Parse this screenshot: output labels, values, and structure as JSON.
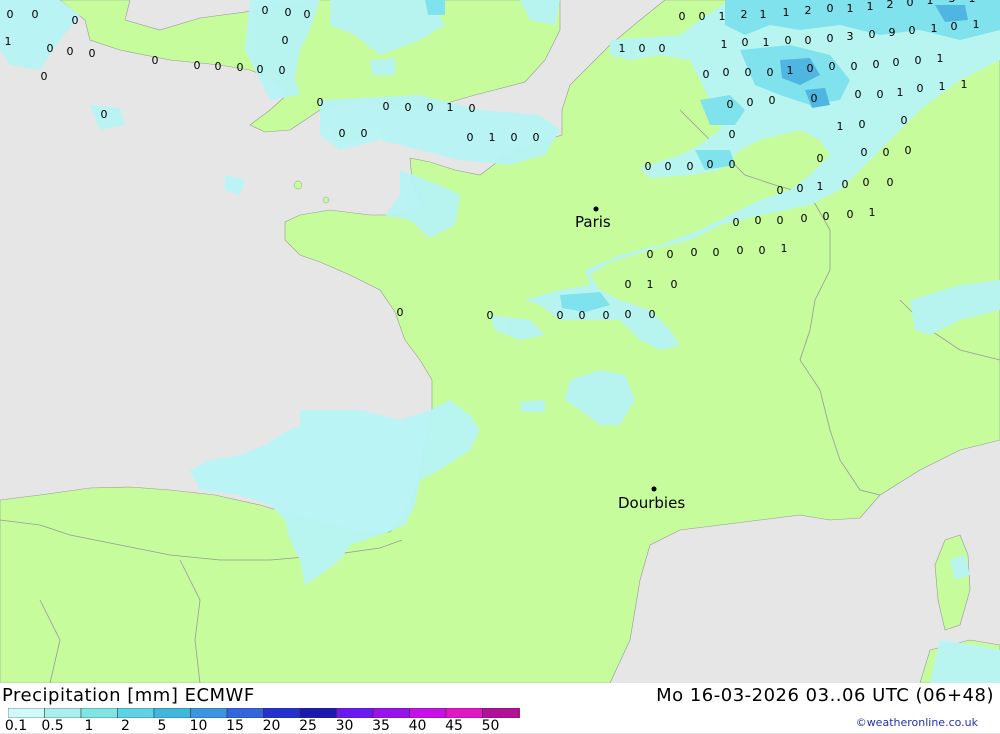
{
  "map": {
    "cities": [
      {
        "name": "Paris"
      },
      {
        "name": "Dourbies"
      }
    ],
    "value_labels": [
      "0",
      "0",
      "0",
      "0",
      "1",
      "0",
      "0",
      "0",
      "0",
      "0",
      "0",
      "0",
      "0",
      "0",
      "0",
      "0",
      "0",
      "0",
      "0",
      "0",
      "0",
      "0",
      "0",
      "0",
      "1",
      "0",
      "0",
      "0",
      "0",
      "1",
      "0",
      "0",
      "1",
      "0",
      "0",
      "0",
      "0",
      "1",
      "2",
      "1",
      "1",
      "2",
      "0",
      "1",
      "1",
      "2",
      "0",
      "1",
      "3",
      "1",
      "1",
      "0",
      "1",
      "0",
      "0",
      "0",
      "3",
      "0",
      "9",
      "0",
      "1",
      "0",
      "1",
      "0",
      "0",
      "0",
      "0",
      "1",
      "0",
      "0",
      "0",
      "0",
      "0",
      "0",
      "1",
      "0",
      "0",
      "0",
      "0",
      "0",
      "0",
      "1",
      "0",
      "1",
      "1",
      "1",
      "0",
      "0",
      "0",
      "0",
      "0",
      "0",
      "0",
      "0",
      "0",
      "0",
      "0",
      "0",
      "0",
      "0",
      "1",
      "0",
      "0",
      "0",
      "0",
      "0",
      "0",
      "0",
      "0",
      "0",
      "1",
      "0",
      "0",
      "0",
      "0",
      "0",
      "0",
      "1",
      "0",
      "1",
      "0",
      "0",
      "0",
      "0",
      "0",
      "0",
      "0",
      "0"
    ]
  },
  "footer": {
    "title": "Precipitation [mm] ECMWF",
    "datetime": "Mo 16-03-2026 03..06 UTC (06+48)",
    "credit": "©weatheronline.co.uk"
  },
  "legend": {
    "labels": [
      "0.1",
      "0.5",
      "1",
      "2",
      "5",
      "10",
      "15",
      "20",
      "25",
      "30",
      "35",
      "40",
      "45",
      "50"
    ],
    "colors": [
      "#cffafa",
      "#a8f0f0",
      "#7fe6e6",
      "#5cd4e6",
      "#3fb8e0",
      "#3a96e0",
      "#3366dd",
      "#2233cc",
      "#1a1aaa",
      "#6a1aee",
      "#9a12e8",
      "#c810e6",
      "#de18c8",
      "#b0109a"
    ]
  }
}
